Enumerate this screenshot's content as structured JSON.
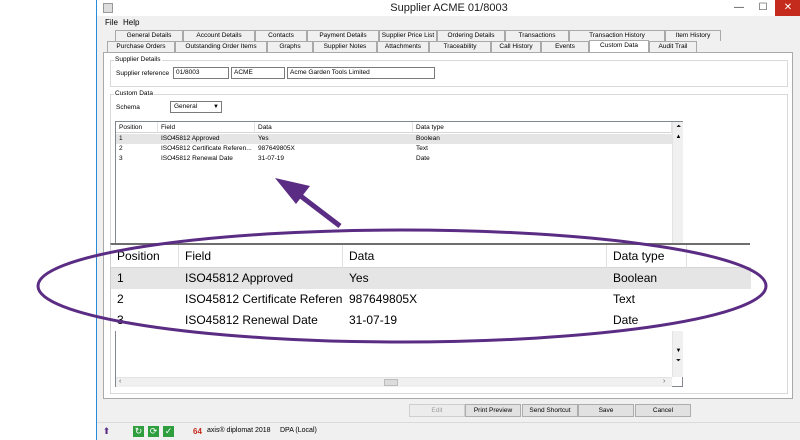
{
  "window": {
    "title": "Supplier ACME 01/8003",
    "controls": [
      "—",
      "☐",
      "✕"
    ]
  },
  "menu": [
    "File",
    "Help"
  ],
  "tabs_row1": [
    "General Details",
    "Account Details",
    "Contacts",
    "Payment Details",
    "Supplier Price List",
    "Ordering Details",
    "Transactions",
    "Transaction History",
    "Item History"
  ],
  "tabs_row2": [
    "Purchase Orders",
    "Outstanding Order Items",
    "Graphs",
    "Supplier Notes",
    "Attachments",
    "Traceability",
    "Call History",
    "Events",
    "Custom Data",
    "Audit Trail"
  ],
  "supplier_details": {
    "group_label": "Supplier Details",
    "ref_label": "Supplier reference",
    "ref_value": "01/8003",
    "code_value": "ACME",
    "name_value": "Acme Garden Tools Limited"
  },
  "custom_data": {
    "group_label": "Custom Data",
    "schema_label": "Schema",
    "schema_value": "General",
    "columns": [
      "Position",
      "Field",
      "Data",
      "Data type"
    ],
    "rows": [
      [
        "1",
        "ISO45812 Approved",
        "Yes",
        "Boolean"
      ],
      [
        "2",
        "ISO45812 Certificate Referen...",
        "987649805X",
        "Text"
      ],
      [
        "3",
        "ISO45812 Renewal Date",
        "31-07-19",
        "Date"
      ]
    ]
  },
  "buttons": {
    "edit": "Edit",
    "print_preview": "Print Preview",
    "send_shortcut": "Send Shortcut",
    "save": "Save",
    "cancel": "Cancel"
  },
  "status": {
    "product": "axis® diplomat 2018",
    "connection": "DPA (Local)"
  },
  "colors": {
    "accent": "#5b2c83",
    "title_close": "#c42b1c",
    "selected_row": "#e5e5e5"
  }
}
